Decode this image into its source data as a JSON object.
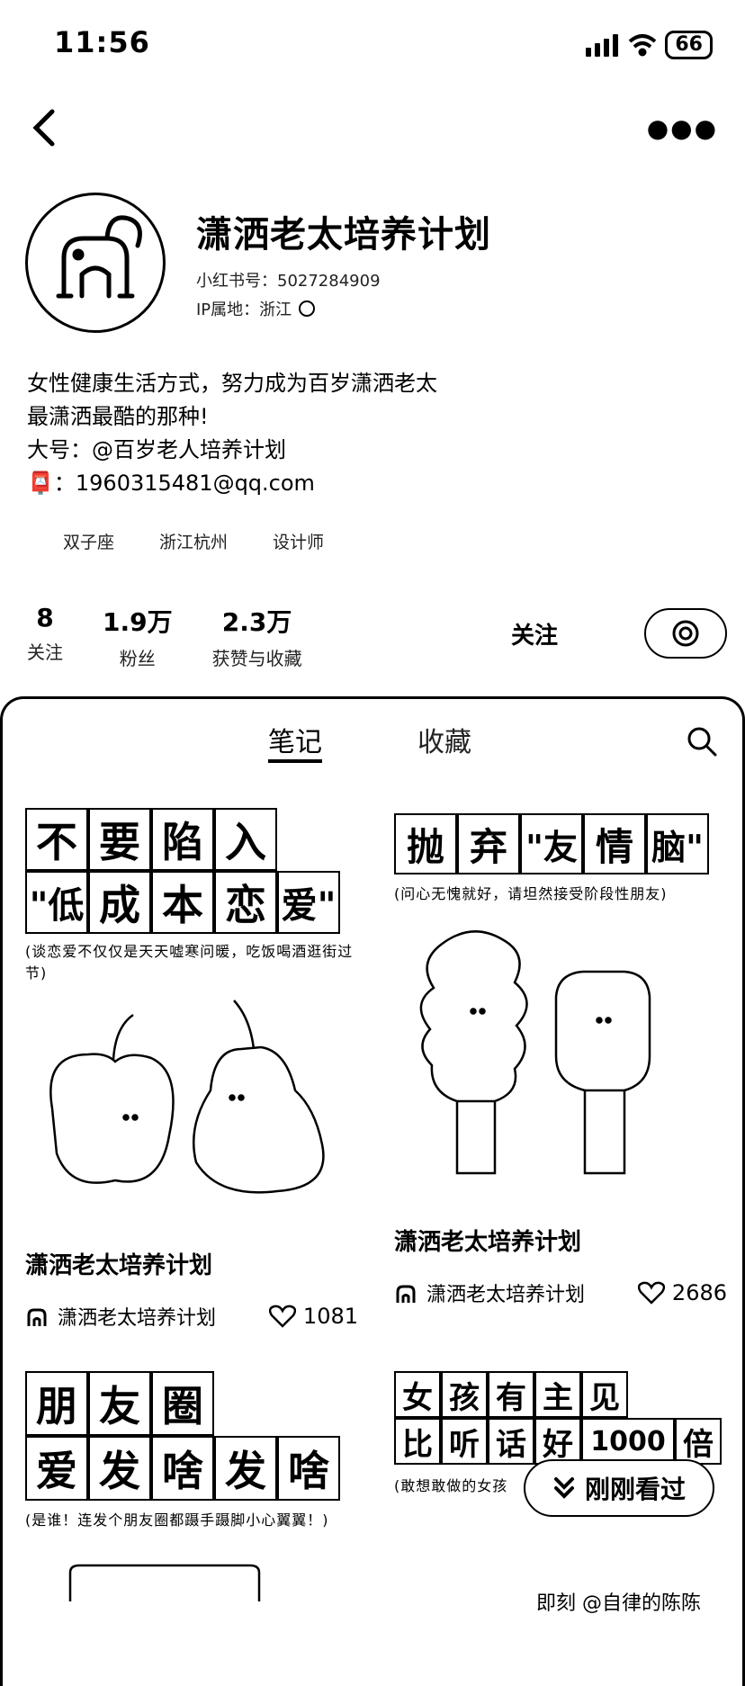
{
  "status": {
    "time": "11:56",
    "battery": "66"
  },
  "profile": {
    "name": "潇洒老太培养计划",
    "id_line": "小红书号：5027284909",
    "ip_line": "IP属地：浙江",
    "bio_lines": [
      "女性健康生活方式，努力成为百岁潇洒老太",
      "最潇洒最酷的那种!",
      "大号：@百岁老人培养计划",
      "📮：1960315481@qq.com"
    ],
    "tags": [
      "双子座",
      "浙江杭州",
      "设计师"
    ]
  },
  "stats": [
    {
      "num": "8",
      "label": "关注"
    },
    {
      "num": "1.9万",
      "label": "粉丝"
    },
    {
      "num": "2.3万",
      "label": "获赞与收藏"
    }
  ],
  "follow_label": "关注",
  "tabs": [
    "笔记",
    "收藏"
  ],
  "notes": [
    {
      "row1": [
        "不",
        "要",
        "陷",
        "入"
      ],
      "row2": [
        "\"低",
        "成",
        "本",
        "恋",
        "爱\""
      ],
      "caption": "(谈恋爱不仅仅是天天嘘寒问暖，吃饭喝酒逛街过节)",
      "title": "潇洒老太培养计划",
      "author": "潇洒老太培养计划",
      "likes": "1081"
    },
    {
      "row1": [
        "抛",
        "弃",
        "\"友",
        "情",
        "脑\""
      ],
      "caption": "(问心无愧就好，请坦然接受阶段性朋友)",
      "title": "潇洒老太培养计划",
      "author": "潇洒老太培养计划",
      "likes": "2686"
    },
    {
      "row1": [
        "朋",
        "友",
        "圈"
      ],
      "row2": [
        "爱",
        "发",
        "啥",
        "发",
        "啥"
      ],
      "caption": "(是谁！连发个朋友圈都蹑手蹑脚小心翼翼！)"
    },
    {
      "row1": [
        "女",
        "孩",
        "有",
        "主",
        "见"
      ],
      "row2": [
        "比",
        "听",
        "话",
        "好",
        "1000",
        "倍"
      ],
      "caption": "(敢想敢做的女孩"
    }
  ],
  "seen_label": "刚刚看过",
  "watermark": "即刻 @自律的陈陈"
}
